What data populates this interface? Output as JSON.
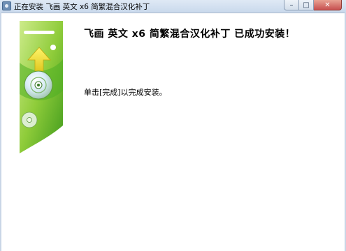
{
  "window": {
    "title": "正在安装 飞画 英文 x6 简繁混合汉化补丁",
    "minimize_glyph": "–",
    "maximize_glyph": "□",
    "close_glyph": "✕"
  },
  "content": {
    "heading": "飞画 英文 x6 简繁混合汉化补丁 已成功安装！",
    "message": "单击[完成]以完成安装。"
  },
  "side_graphic": {
    "icons": [
      "up-arrow-icon",
      "disc-icon"
    ],
    "colors": {
      "green_light": "#b8e06a",
      "green_dark": "#3f9a1c",
      "arrow": "#f3e23a"
    }
  }
}
